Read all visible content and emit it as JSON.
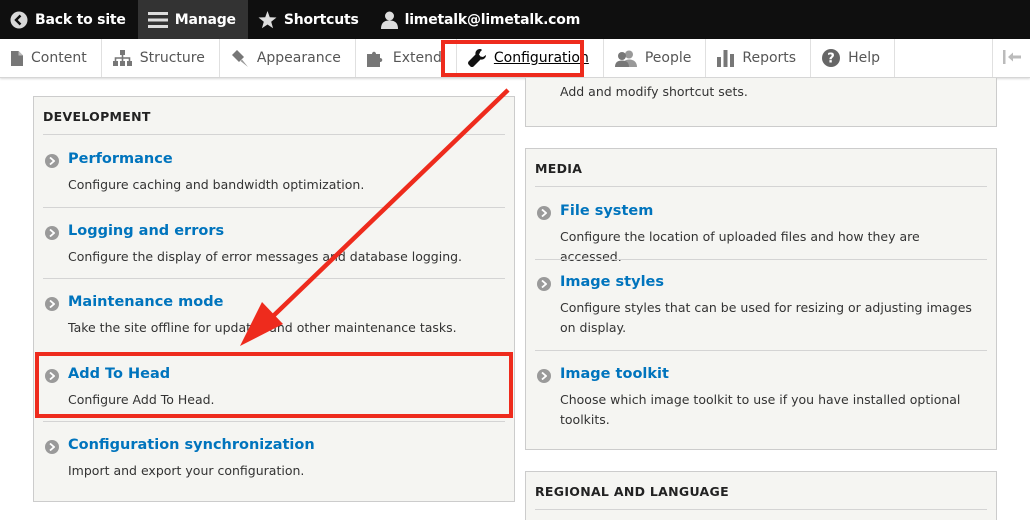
{
  "toolbar": {
    "back": "Back to site",
    "manage": "Manage",
    "shortcuts": "Shortcuts",
    "user": "limetalk@limetalk.com"
  },
  "tray": [
    {
      "label": "Content",
      "icon": "file-icon"
    },
    {
      "label": "Structure",
      "icon": "sitemap-icon"
    },
    {
      "label": "Appearance",
      "icon": "paintbrush-icon"
    },
    {
      "label": "Extend",
      "icon": "puzzle-icon"
    },
    {
      "label": "Configuration",
      "icon": "wrench-icon"
    },
    {
      "label": "People",
      "icon": "people-icon"
    },
    {
      "label": "Reports",
      "icon": "bar-chart-icon"
    },
    {
      "label": "Help",
      "icon": "question-icon"
    }
  ],
  "development": {
    "heading": "DEVELOPMENT",
    "items": [
      {
        "title": "Performance",
        "desc": "Configure caching and bandwidth optimization."
      },
      {
        "title": "Logging and errors",
        "desc": "Configure the display of error messages and database logging."
      },
      {
        "title": "Maintenance mode",
        "desc": "Take the site offline for updates and other maintenance tasks."
      },
      {
        "title": "Add To Head",
        "desc": "Configure Add To Head."
      },
      {
        "title": "Configuration synchronization",
        "desc": "Import and export your configuration."
      }
    ]
  },
  "shortcut_partial": {
    "desc": "Add and modify shortcut sets."
  },
  "media": {
    "heading": "MEDIA",
    "items": [
      {
        "title": "File system",
        "desc": "Configure the location of uploaded files and how they are accessed."
      },
      {
        "title": "Image styles",
        "desc": "Configure styles that can be used for resizing or adjusting images on display."
      },
      {
        "title": "Image toolkit",
        "desc": "Choose which image toolkit to use if you have installed optional toolkits."
      }
    ]
  },
  "regional": {
    "heading": "REGIONAL AND LANGUAGE"
  },
  "colors": {
    "highlight": "#ee2b1d",
    "link": "#0074bd"
  }
}
